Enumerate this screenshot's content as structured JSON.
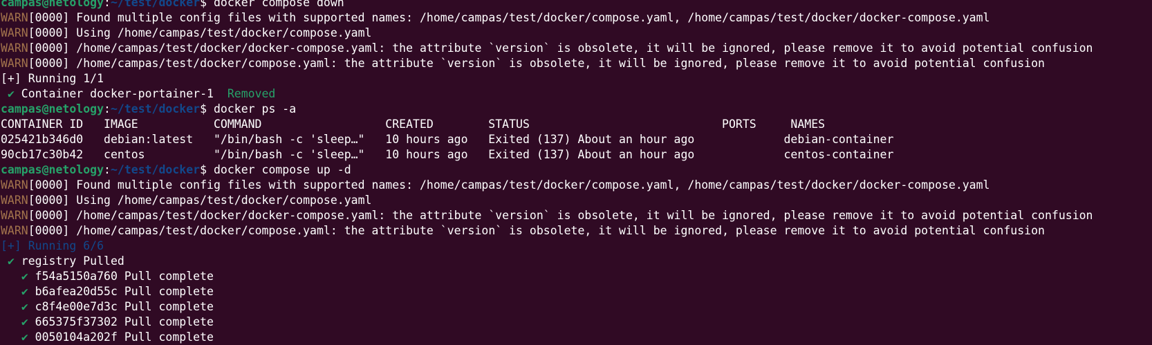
{
  "colors": {
    "background": "#300a24",
    "foreground": "#ffffff",
    "prompt_user": "#26a269",
    "prompt_path": "#12488b",
    "warn": "#a2734c",
    "success": "#26a269"
  },
  "lines": [
    {
      "kind": "prompt",
      "user": "campas@netology",
      "sep": ":",
      "path": "~/test/docker",
      "sym": "$ ",
      "cmd": "docker compose down"
    },
    {
      "kind": "warn",
      "tag": "WARN",
      "text": "[0000] Found multiple config files with supported names: /home/campas/test/docker/compose.yaml, /home/campas/test/docker/docker-compose.yaml"
    },
    {
      "kind": "warn",
      "tag": "WARN",
      "text": "[0000] Using /home/campas/test/docker/compose.yaml"
    },
    {
      "kind": "warn",
      "tag": "WARN",
      "text": "[0000] /home/campas/test/docker/docker-compose.yaml: the attribute `version` is obsolete, it will be ignored, please remove it to avoid potential confusion"
    },
    {
      "kind": "warn",
      "tag": "WARN",
      "text": "[0000] /home/campas/test/docker/compose.yaml: the attribute `version` is obsolete, it will be ignored, please remove it to avoid potential confusion"
    },
    {
      "kind": "plain",
      "text": "[+] Running 1/1"
    },
    {
      "kind": "status",
      "indent": " ",
      "check": "✔",
      "text": " Container docker-portainer-1  ",
      "status": "Removed"
    },
    {
      "kind": "prompt",
      "user": "campas@netology",
      "sep": ":",
      "path": "~/test/docker",
      "sym": "$ ",
      "cmd": "docker ps -a"
    },
    {
      "kind": "plain",
      "text": "CONTAINER ID   IMAGE           COMMAND                  CREATED        STATUS                            PORTS     NAMES"
    },
    {
      "kind": "plain",
      "text": "025421b346d0   debian:latest   \"/bin/bash -c 'sleep…\"   10 hours ago   Exited (137) About an hour ago             debian-container"
    },
    {
      "kind": "plain",
      "text": "90cb17c30b42   centos          \"/bin/bash -c 'sleep…\"   10 hours ago   Exited (137) About an hour ago             centos-container"
    },
    {
      "kind": "prompt",
      "user": "campas@netology",
      "sep": ":",
      "path": "~/test/docker",
      "sym": "$ ",
      "cmd": "docker compose up -d"
    },
    {
      "kind": "warn",
      "tag": "WARN",
      "text": "[0000] Found multiple config files with supported names: /home/campas/test/docker/compose.yaml, /home/campas/test/docker/docker-compose.yaml"
    },
    {
      "kind": "warn",
      "tag": "WARN",
      "text": "[0000] Using /home/campas/test/docker/compose.yaml"
    },
    {
      "kind": "warn",
      "tag": "WARN",
      "text": "[0000] /home/campas/test/docker/docker-compose.yaml: the attribute `version` is obsolete, it will be ignored, please remove it to avoid potential confusion"
    },
    {
      "kind": "warn",
      "tag": "WARN",
      "text": "[0000] /home/campas/test/docker/compose.yaml: the attribute `version` is obsolete, it will be ignored, please remove it to avoid potential confusion"
    },
    {
      "kind": "dim",
      "text": "[+] Running 6/6"
    },
    {
      "kind": "status",
      "indent": " ",
      "check": "✔",
      "text": " registry Pulled",
      "status": ""
    },
    {
      "kind": "status",
      "indent": "   ",
      "check": "✔",
      "text": " f54a5150a760 Pull complete",
      "status": ""
    },
    {
      "kind": "status",
      "indent": "   ",
      "check": "✔",
      "text": " b6afea20d55c Pull complete",
      "status": ""
    },
    {
      "kind": "status",
      "indent": "   ",
      "check": "✔",
      "text": " c8f4e00e7d3c Pull complete",
      "status": ""
    },
    {
      "kind": "status",
      "indent": "   ",
      "check": "✔",
      "text": " 665375f37302 Pull complete",
      "status": ""
    },
    {
      "kind": "status",
      "indent": "   ",
      "check": "✔",
      "text": " 0050104a202f Pull complete",
      "status": ""
    }
  ]
}
